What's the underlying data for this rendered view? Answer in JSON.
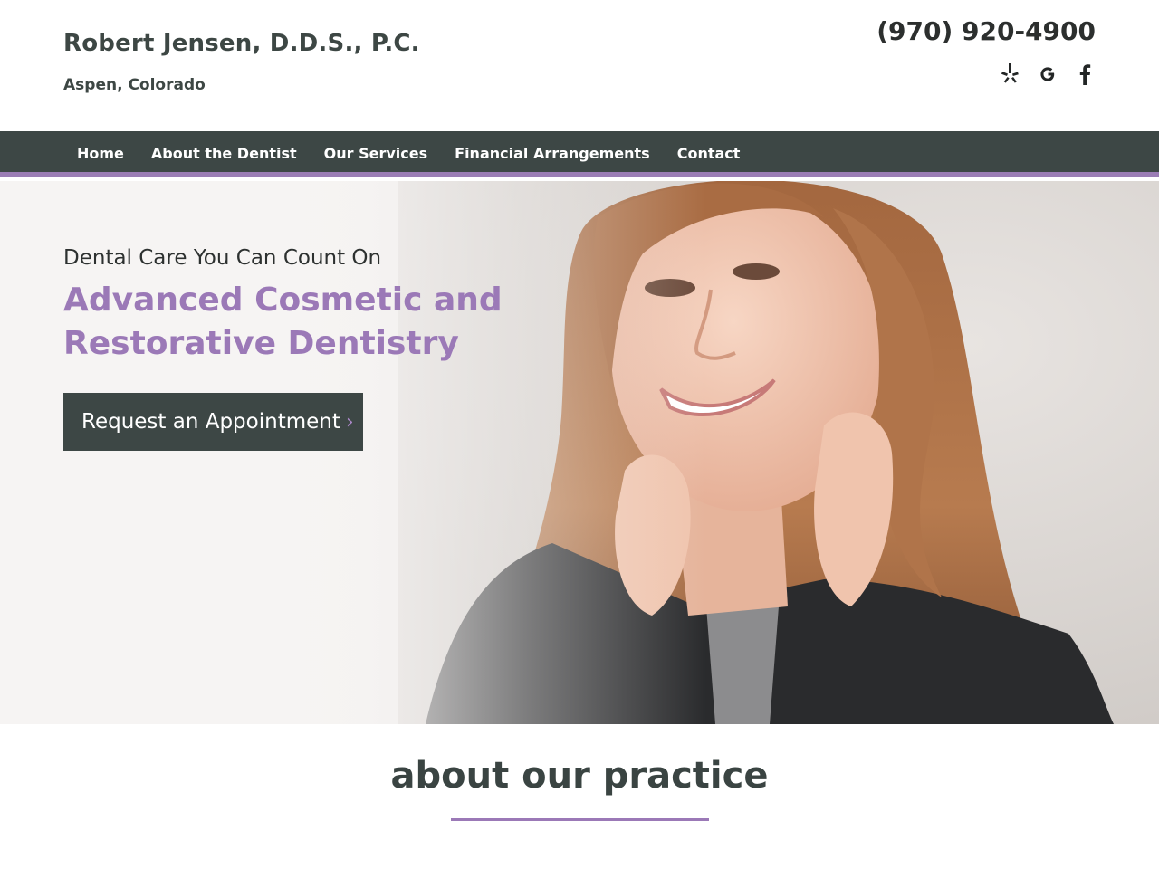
{
  "header": {
    "practice_name": "Robert Jensen, D.D.S., P.C.",
    "location": "Aspen, Colorado",
    "phone": "(970) 920-4900",
    "social": [
      {
        "icon": "yelp-icon",
        "label": "Yelp"
      },
      {
        "icon": "google-icon",
        "label": "G"
      },
      {
        "icon": "facebook-icon",
        "label": "f"
      }
    ]
  },
  "nav": {
    "items": [
      {
        "label": "Home"
      },
      {
        "label": "About the Dentist"
      },
      {
        "label": "Our Services"
      },
      {
        "label": "Financial Arrangements"
      },
      {
        "label": "Contact"
      }
    ]
  },
  "hero": {
    "tagline": "Dental Care You Can Count On",
    "title": "Advanced Cosmetic and Restorative Dentistry",
    "cta_label": "Request an Appointment",
    "cta_icon": "chevron-right-icon"
  },
  "about": {
    "heading": "about our practice"
  },
  "colors": {
    "accent": "#9b79b7",
    "nav_bg": "#3d4745",
    "text_dark": "#3d4744"
  }
}
